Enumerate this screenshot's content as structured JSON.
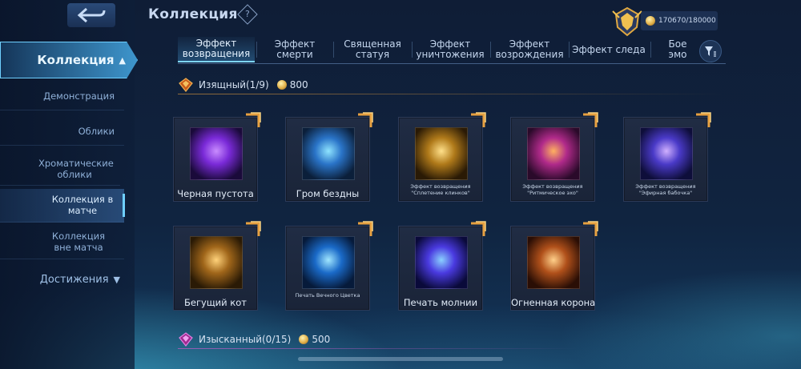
{
  "header": {
    "title": "Коллекция",
    "help": "?",
    "currency": "170670/180000"
  },
  "sidebar": {
    "main": "Коллекция",
    "items": [
      {
        "label": "Демонстрация"
      },
      {
        "label": "Облики"
      },
      {
        "label": "Хроматические облики"
      },
      {
        "label": "Коллекция в матче"
      },
      {
        "label": "Коллекция вне матча"
      }
    ],
    "achievements": "Достижения"
  },
  "tabs": [
    {
      "label": "Эффект возвращения"
    },
    {
      "label": "Эффект смерти"
    },
    {
      "label": "Священная статуя"
    },
    {
      "label": "Эффект уничтожения"
    },
    {
      "label": "Эффект возрождения"
    },
    {
      "label": "Эффект следа"
    },
    {
      "label": "Бое эмо"
    }
  ],
  "sections": [
    {
      "title": "Изящный(1/9)",
      "points": "800"
    },
    {
      "title": "Изысканный(0/15)",
      "points": "500"
    }
  ],
  "cards": [
    {
      "name": "Черная пустота",
      "small": false,
      "colors": [
        "#1a0a3a",
        "#7a2ad8",
        "#c98cff"
      ]
    },
    {
      "name": "Гром бездны",
      "small": false,
      "colors": [
        "#0b1f3a",
        "#2a74c8",
        "#8fe4ff"
      ]
    },
    {
      "name": "Эффект возвращения \"Сплетение клинков\"",
      "small": true,
      "colors": [
        "#2a1a05",
        "#b07a1a",
        "#ffe08a"
      ]
    },
    {
      "name": "Эффект возвращения \"Ритмическое эхо\"",
      "small": true,
      "colors": [
        "#2a0a2a",
        "#b02a8a",
        "#ffb060"
      ]
    },
    {
      "name": "Эффект возвращения \"Эфирная бабочка\"",
      "small": true,
      "colors": [
        "#0e0e3a",
        "#4a3ac8",
        "#d0b0ff"
      ]
    },
    {
      "name": "Бегущий кот",
      "small": false,
      "colors": [
        "#2a1a05",
        "#a0661a",
        "#ffd27a"
      ]
    },
    {
      "name": "Печать Вечного Цветка",
      "small": true,
      "colors": [
        "#061a3a",
        "#1a6ac8",
        "#a0e6ff"
      ]
    },
    {
      "name": "Печать молнии",
      "small": false,
      "colors": [
        "#0a0a3a",
        "#4a3ae0",
        "#8ad0ff"
      ]
    },
    {
      "name": "Огненная корона",
      "small": false,
      "colors": [
        "#2a0e05",
        "#b0501a",
        "#ffd08a"
      ]
    }
  ]
}
